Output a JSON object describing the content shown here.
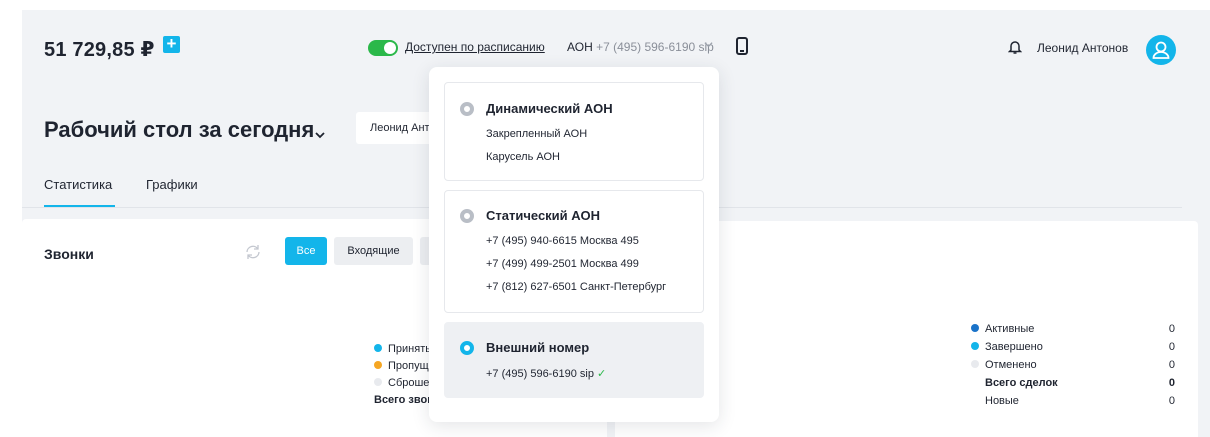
{
  "topbar": {
    "balance": "51 729,85 ₽",
    "availability": "Доступен по расписанию",
    "aon_label": "АОН",
    "aon_number": "+7 (495) 596-6190 sip",
    "user_name": "Леонид Антонов"
  },
  "header": {
    "title": "Рабочий стол за сегодня",
    "user_filter": "Леонид Антонов"
  },
  "tabs": [
    {
      "label": "Статистика",
      "active": true
    },
    {
      "label": "Графики",
      "active": false
    }
  ],
  "calls": {
    "title": "Звонки",
    "filters": [
      "Все",
      "Входящие"
    ],
    "legend": [
      {
        "label": "Приняты",
        "color": "#13b5ea"
      },
      {
        "label": "Пропущены",
        "color": "#f5a623"
      },
      {
        "label": "Сброшены",
        "color": "#e8eaee"
      }
    ],
    "total_label": "Всего звонков"
  },
  "deals": {
    "legend": [
      {
        "label": "Активные",
        "value": "0",
        "color": "#1a73c9"
      },
      {
        "label": "Завершено",
        "value": "0",
        "color": "#13b5ea"
      },
      {
        "label": "Отменено",
        "value": "0",
        "color": "#e8eaee"
      }
    ],
    "total_label": "Всего сделок",
    "total_value": "0",
    "new_label": "Новые",
    "new_value": "0"
  },
  "aon_dropdown": {
    "dynamic": {
      "title": "Динамический АОН",
      "items": [
        "Закрепленный АОН",
        "Карусель АОН"
      ]
    },
    "static": {
      "title": "Статический АОН",
      "items": [
        "+7 (495) 940-6615 Москва 495",
        "+7 (499) 499-2501 Москва 499",
        "+7 (812) 627-6501 Санкт-Петербург"
      ]
    },
    "external": {
      "title": "Внешний номер",
      "number": "+7 (495) 596-6190 sip",
      "selected": true
    }
  },
  "colors": {
    "accent": "#13b5ea",
    "toggle_on": "#2bb84a",
    "background": "#f1f3f6"
  },
  "icons": [
    "plus-icon",
    "toggle",
    "chevron-down-icon",
    "phone-icon",
    "bell-icon",
    "user-icon",
    "refresh-icon",
    "check-icon"
  ]
}
